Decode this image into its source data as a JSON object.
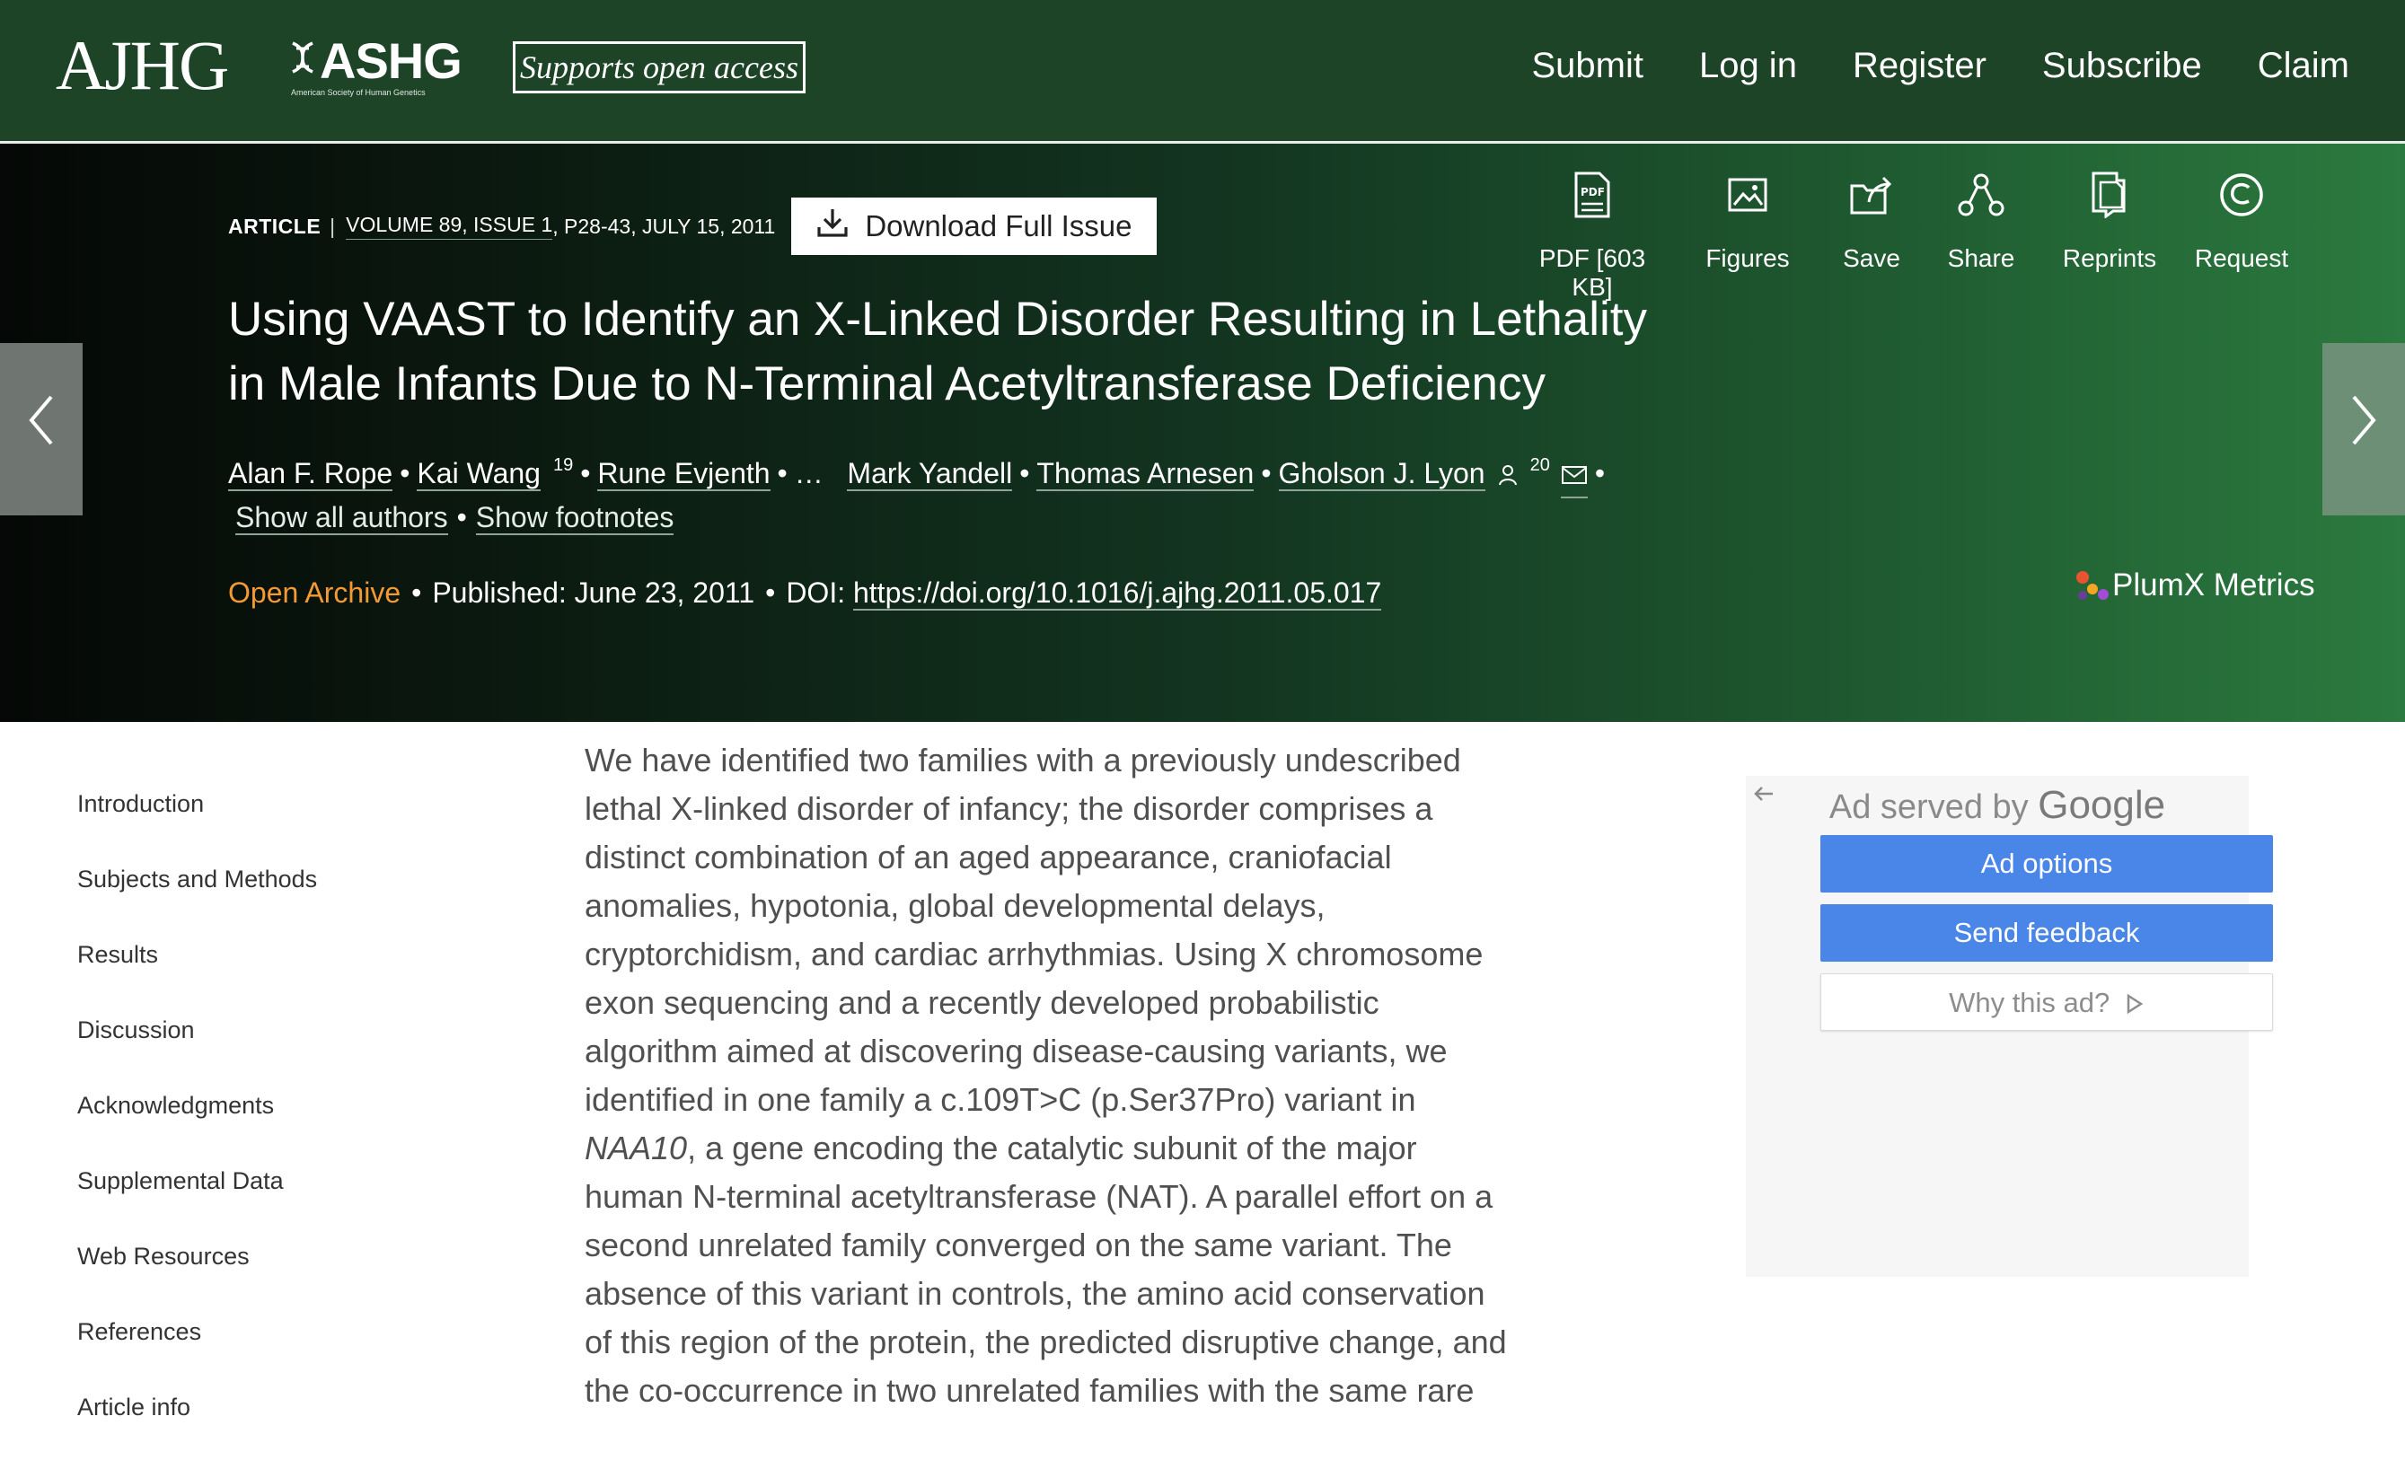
{
  "header": {
    "journal_logo": "AJHG",
    "society_logo": "ASHG",
    "society_subtitle": "American Society of Human Genetics",
    "open_access_badge": "Supports open access",
    "nav": [
      "Submit",
      "Log in",
      "Register",
      "Subscribe",
      "Claim"
    ]
  },
  "article": {
    "type": "ARTICLE",
    "volume": "VOLUME 89, ISSUE 1",
    "pages": ", P28-43, JULY 15, 2011",
    "download_label": "Download Full Issue",
    "title": "Using VAAST to Identify an X-Linked Disorder Resulting in Lethality in Male Infants Due to N-Terminal Acetyltransferase Deficiency",
    "authors": {
      "a1": "Alan F. Rope",
      "a2": "Kai Wang",
      "a2_sup": "19",
      "a3": "Rune Evjenth",
      "ellipsis": "…",
      "a4": "Mark Yandell",
      "a5": "Thomas Arnesen",
      "a6": "Gholson J. Lyon",
      "a6_sup": "20"
    },
    "show_all_authors": "Show all authors",
    "show_footnotes": "Show footnotes",
    "access": "Open Archive",
    "published": "Published: June 23, 2011",
    "doi_label": "DOI:",
    "doi": "https://doi.org/10.1016/j.ajhg.2011.05.017",
    "plumx": "PlumX Metrics"
  },
  "tools": {
    "pdf": "PDF [603 KB]",
    "figures": "Figures",
    "save": "Save",
    "share": "Share",
    "reprints": "Reprints",
    "request": "Request",
    "pdf_badge": "PDF"
  },
  "toc": [
    "Introduction",
    "Subjects and Methods",
    "Results",
    "Discussion",
    "Acknowledgments",
    "Supplemental Data",
    "Web Resources",
    "References",
    "Article info"
  ],
  "abstract": {
    "part1": "We have identified two families with a previously undescribed lethal X-linked disorder of infancy; the disorder comprises a distinct combination of an aged appearance, craniofacial anomalies, hypotonia, global developmental delays, cryptorchidism, and cardiac arrhythmias. Using X chromosome exon sequencing and a recently developed probabilistic algorithm aimed at discovering disease-causing variants, we identified in one family a c.109T>C (p.Ser37Pro) variant in ",
    "gene": "NAA10",
    "part2": ", a gene encoding the catalytic subunit of the major human N-terminal acetyltransferase (NAT). A parallel effort on a second unrelated family converged on the same variant. The absence of this variant in controls, the amino acid conservation of this region of the protein, the predicted disruptive change, and the co-occurrence in two unrelated families with the same rare"
  },
  "ad": {
    "served_by": "Ad served by",
    "google": "Google",
    "options": "Ad options",
    "feedback": "Send feedback",
    "why": "Why this ad?"
  },
  "colors": {
    "header_bg": "#1e4427",
    "open_archive": "#f39a35",
    "ad_button": "#4a86e8"
  }
}
